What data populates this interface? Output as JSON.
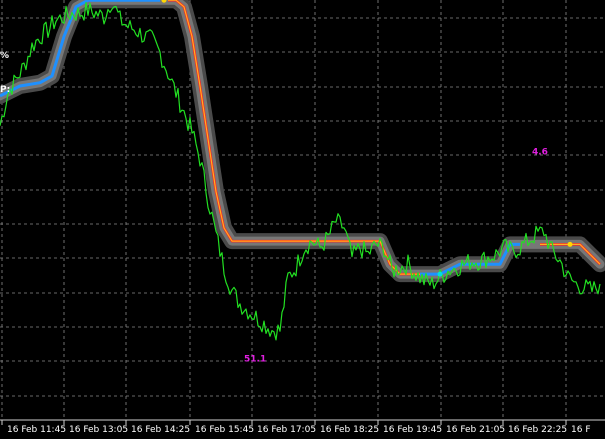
{
  "chart_data": {
    "type": "line",
    "title": "",
    "xlabel": "",
    "ylabel": "",
    "grid": true,
    "categories": [
      "16 Feb 11:45",
      "16 Feb 13:05",
      "16 Feb 14:25",
      "16 Feb 15:45",
      "16 Feb 17:05",
      "16 Feb 18:25",
      "16 Feb 19:45",
      "16 Feb 21:05",
      "16 Feb 22:25",
      "16 F"
    ],
    "xlim": [
      0,
      300
    ],
    "ylim": [
      0,
      100
    ],
    "side_labels": [
      "%",
      "P:"
    ],
    "annotations": [
      {
        "text": "51.1",
        "x": 128,
        "y": 2
      },
      {
        "text": "4.6",
        "x": 268,
        "y": 58
      }
    ],
    "series": [
      {
        "kind": "price",
        "color": "#22e022",
        "x": [
          0,
          4,
          8,
          12,
          16,
          20,
          24,
          28,
          32,
          36,
          40,
          44,
          48,
          52,
          56,
          60,
          64,
          68,
          72,
          76,
          80,
          84,
          88,
          92,
          96,
          100,
          104,
          108,
          112,
          116,
          120,
          124,
          128,
          132,
          136,
          140,
          144,
          148,
          152,
          156,
          160,
          164,
          168,
          172,
          176,
          180,
          184,
          188,
          192,
          196,
          200,
          204,
          208,
          212,
          216,
          220,
          224,
          228,
          232,
          236,
          240,
          244,
          248,
          252,
          256,
          260,
          264,
          268,
          272,
          276,
          280,
          284,
          288,
          292,
          296,
          300
        ],
        "y": [
          68,
          78,
          82,
          86,
          92,
          95,
          97,
          100,
          101,
          102,
          102,
          103,
          102,
          101,
          106,
          100,
          98,
          97,
          95,
          94,
          90,
          84,
          78,
          72,
          66,
          58,
          46,
          35,
          25,
          18,
          14,
          12,
          10,
          8,
          6,
          6,
          22,
          25,
          31,
          33,
          31,
          34,
          39,
          37,
          28,
          31,
          29,
          32,
          31,
          24,
          25,
          26,
          23,
          21,
          20,
          22,
          24,
          25,
          26,
          27,
          27,
          28,
          29,
          31,
          30,
          31,
          33,
          35,
          36,
          30,
          27,
          22,
          20,
          19,
          18,
          20
        ]
      },
      {
        "kind": "trend-line",
        "x": [
          0,
          10,
          20,
          26,
          32,
          38,
          44,
          50,
          56,
          60,
          64,
          68,
          72,
          76,
          80,
          84,
          88,
          92,
          96,
          100,
          104,
          108,
          112,
          116,
          120,
          124,
          128,
          132,
          136,
          140,
          150,
          160,
          170,
          180,
          190,
          195,
          200,
          210,
          220,
          230,
          240,
          250,
          255,
          260,
          270,
          280,
          290,
          300
        ],
        "y": [
          77,
          80,
          81,
          83,
          95,
          104,
          106,
          106,
          106,
          106,
          106,
          106,
          106,
          106,
          106,
          106,
          106,
          104,
          95,
          80,
          64,
          48,
          37,
          33,
          33,
          33,
          33,
          33,
          33,
          33,
          33,
          33,
          33,
          33,
          33,
          26,
          23,
          23,
          23,
          26,
          26,
          26,
          32,
          32,
          32,
          32,
          32,
          26
        ],
        "colors_by_segment": [
          {
            "from": 0,
            "to": 82,
            "color": "#1e90ff"
          },
          {
            "from": 82,
            "to": 210,
            "color": "#ffa020"
          },
          {
            "from": 210,
            "to": 268,
            "color": "#1e90ff"
          },
          {
            "from": 268,
            "to": 300,
            "color": "#ffa020"
          }
        ]
      }
    ]
  }
}
